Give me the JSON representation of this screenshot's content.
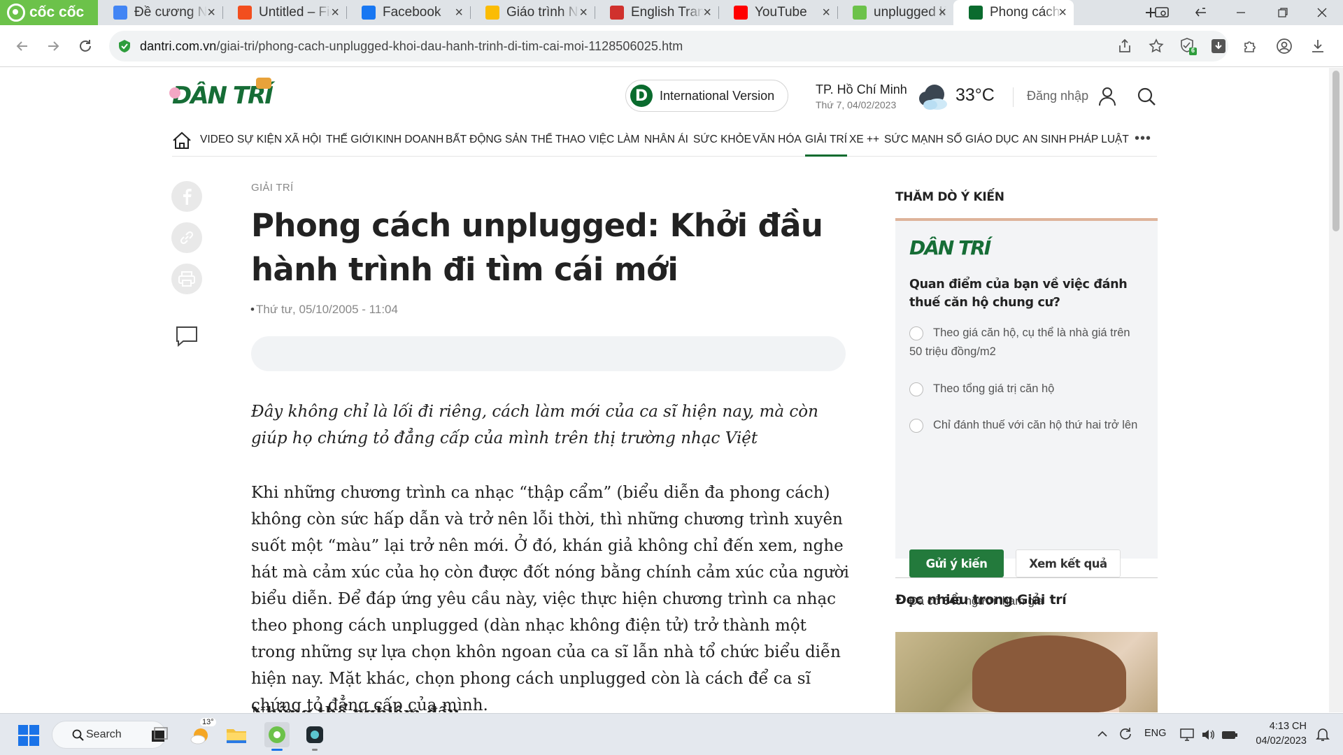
{
  "browser": {
    "brand": "cốc cốc",
    "tabs": [
      {
        "title": "Đề cương NH",
        "favicon": "google-docs-icon",
        "color": "#4285f4"
      },
      {
        "title": "Untitled – Figma",
        "favicon": "figma-icon",
        "color": "#f24e1e"
      },
      {
        "title": "Facebook",
        "favicon": "facebook-icon",
        "color": "#1877f2"
      },
      {
        "title": "Giáo trình NH",
        "favicon": "google-drive-icon",
        "color": "#fbbc04"
      },
      {
        "title": "English Translate",
        "favicon": "cambridge-icon",
        "color": "#d0312d"
      },
      {
        "title": "YouTube",
        "favicon": "youtube-icon",
        "color": "#ff0000"
      },
      {
        "title": "unplugged là gì",
        "favicon": "coccoc-search-icon",
        "color": "#6cc24a"
      },
      {
        "title": "Phong cách unplugged",
        "favicon": "dantri-icon",
        "color": "#0a6b2e",
        "active": true
      }
    ],
    "url_host": "dantri.com.vn",
    "url_path": "/giai-tri/phong-cach-unplugged-khoi-dau-hanh-trinh-di-tim-cai-moi-1128506025.htm",
    "extension_badge": "6"
  },
  "site": {
    "logo_text": "DÂN TRÍ",
    "intl_label": "International Version",
    "intl_badge": "D",
    "city": "TP. Hồ Chí Minh",
    "header_date": "Thứ 7, 04/02/2023",
    "temperature": "33°C",
    "login": "Đăng nhập",
    "menu": [
      "VIDEO",
      "SỰ KIỆN",
      "XÃ HỘI",
      "THẾ GIỚI",
      "KINH DOANH",
      "BẤT ĐỘNG SẢN",
      "THỂ THAO",
      "VIỆC LÀM",
      "NHÂN ÁI",
      "SỨC KHỎE",
      "VĂN HÓA",
      "GIẢI TRÍ",
      "XE ++",
      "SỨC MẠNH SỐ",
      "GIÁO DỤC",
      "AN SINH",
      "PHÁP LUẬT"
    ],
    "menu_more": "•••",
    "active_menu": "GIẢI TRÍ",
    "accent": "#0a6b2e"
  },
  "article": {
    "category": "GIẢI TRÍ",
    "title": "Phong cách unplugged: Khởi đầu hành trình đi tìm cái mới",
    "date": "Thứ tư, 05/10/2005 - 11:04",
    "sapo": "Đây không chỉ là lối đi riêng, cách làm mới của ca sĩ hiện nay, mà còn giúp họ chứng tỏ đẳng cấp của mình trên thị trường nhạc Việt",
    "body_1": "Khi những chương trình ca nhạc “thập cẩm” (biểu diễn đa phong cách) không còn sức hấp dẫn và trở nên lỗi thời, thì những chương trình xuyên suốt một “màu” lại trở nên mới. Ở đó, khán giả không chỉ đến xem, nghe hát mà cảm xúc của họ còn được đốt nóng bằng chính cảm xúc của người biểu diễn. Để đáp ứng yêu cầu này, việc thực hiện chương trình ca nhạc theo phong cách unplugged (dàn nhạc không điện tử) trở thành một trong những sự lựa chọn khôn ngoan của ca sĩ lẫn nhà tổ chức biểu diễn hiện nay. Mặt khác, chọn phong cách unplugged còn là cách để ca sĩ chứng tỏ đẳng cấp của mình.",
    "body_2": "Những thể nghiệm đầu"
  },
  "poll": {
    "heading": "THĂM DÒ Ý KIẾN",
    "logo": "DÂN TRÍ",
    "question": "Quan điểm của bạn về việc đánh thuế căn hộ chung cư?",
    "options": [
      "Theo giá căn hộ, cụ thể là nhà giá trên 50 triệu đồng/m2",
      "Theo tổng giá trị căn hộ",
      "Chỉ đánh thuế với căn hộ thứ hai trở lên"
    ],
    "vote_label": "Gửi ý kiến",
    "results_label": "Xem kết quả",
    "participants_prefix": "Đã có",
    "participants_count": "640",
    "participants_suffix": "người tham gia"
  },
  "popular": {
    "heading": "Đọc nhiều trong Giải trí"
  },
  "taskbar": {
    "search_label": "Search",
    "weather_badge": "13°",
    "lang": "ENG",
    "time": "4:13 CH",
    "date": "04/02/2023"
  }
}
